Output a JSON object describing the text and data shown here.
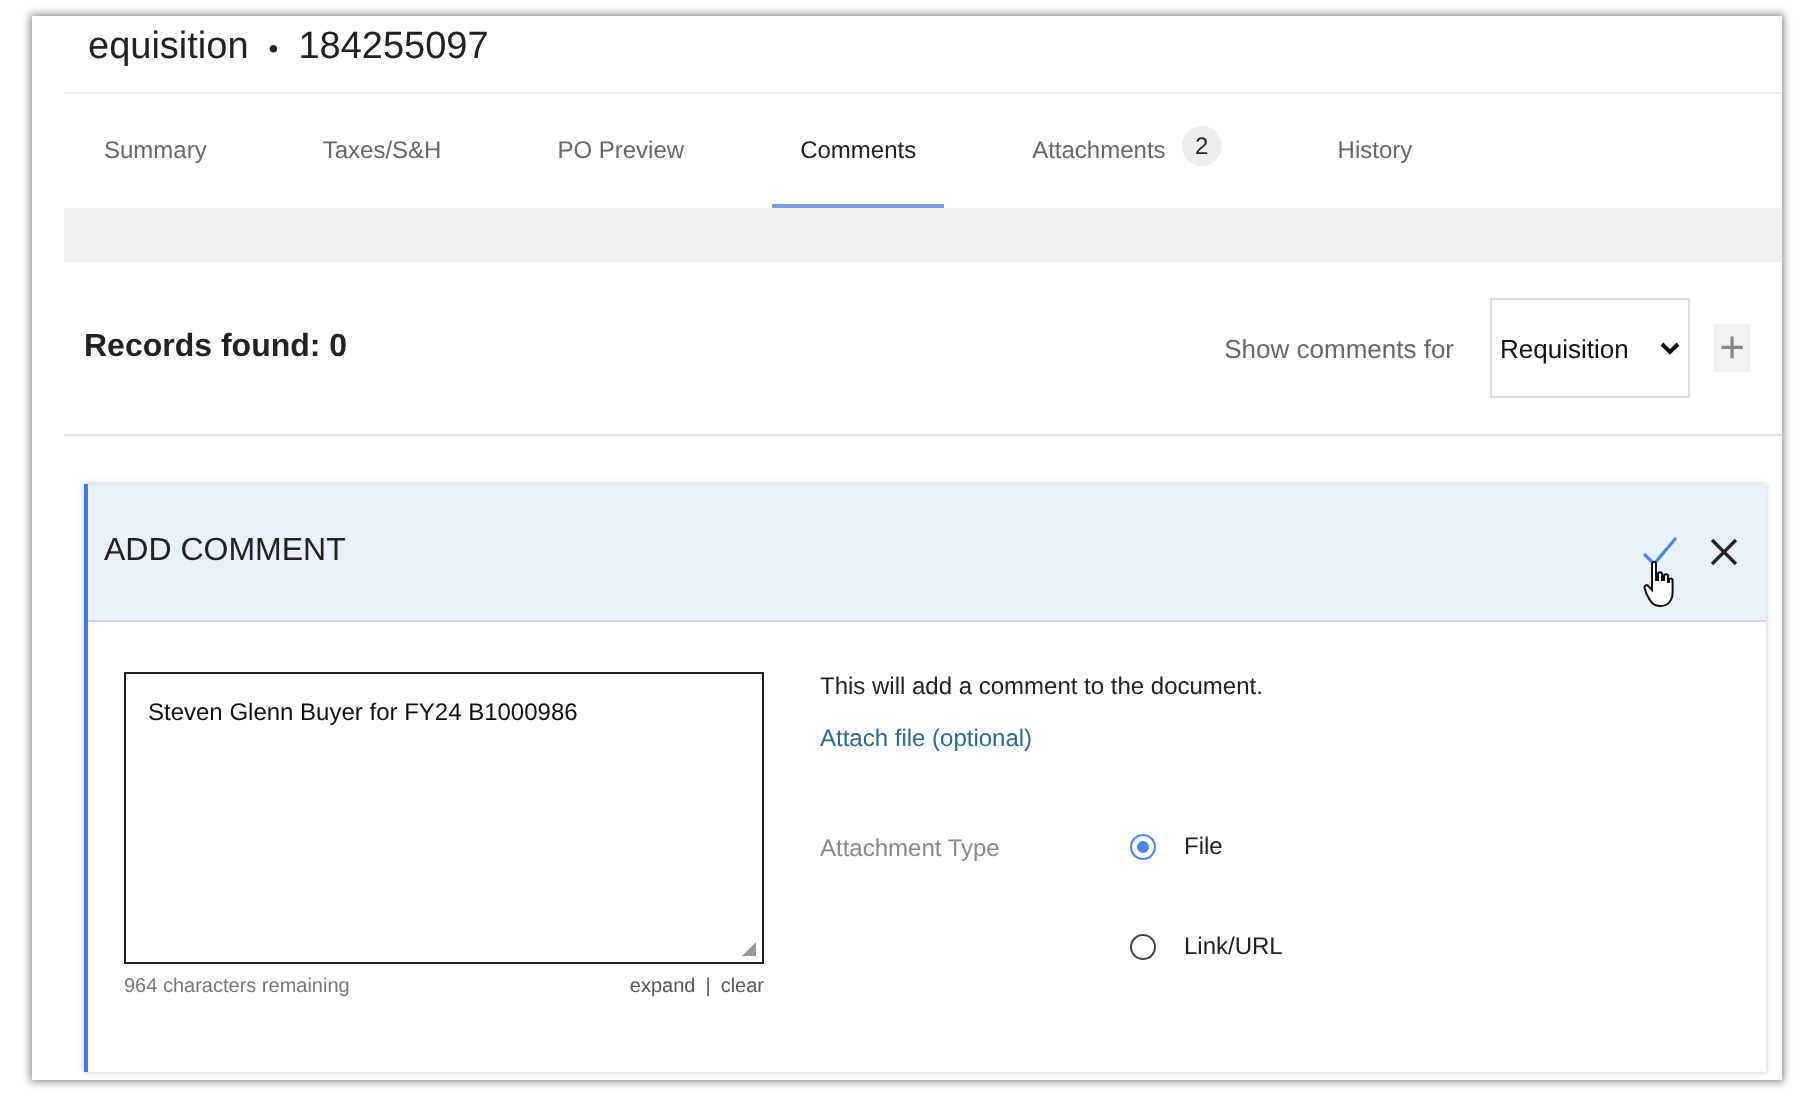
{
  "header": {
    "title": "equisition",
    "separator": "•",
    "number": "184255097"
  },
  "tabs": [
    {
      "label": "Summary",
      "selected": false
    },
    {
      "label": "Taxes/S&H",
      "selected": false
    },
    {
      "label": "PO Preview",
      "selected": false
    },
    {
      "label": "Comments",
      "selected": true
    },
    {
      "label": "Attachments",
      "badge": "2",
      "selected": false
    },
    {
      "label": "History",
      "selected": false
    }
  ],
  "records": {
    "label": "Records found: 0",
    "filter_label": "Show comments for",
    "filter_value": "Requisition",
    "add_button": "+"
  },
  "add_comment": {
    "title": "ADD COMMENT",
    "comment": "Steven Glenn Buyer for FY24 B1000986",
    "remaining": "964 characters remaining",
    "expand": "expand",
    "divider": "|",
    "clear": "clear",
    "info": "This will add a comment to the document.",
    "attach_link": "Attach file (optional)",
    "attachment_type_label": "Attachment Type",
    "attachment_types": [
      {
        "label": "File",
        "selected": true
      },
      {
        "label": "Link/URL",
        "selected": false
      }
    ]
  }
}
